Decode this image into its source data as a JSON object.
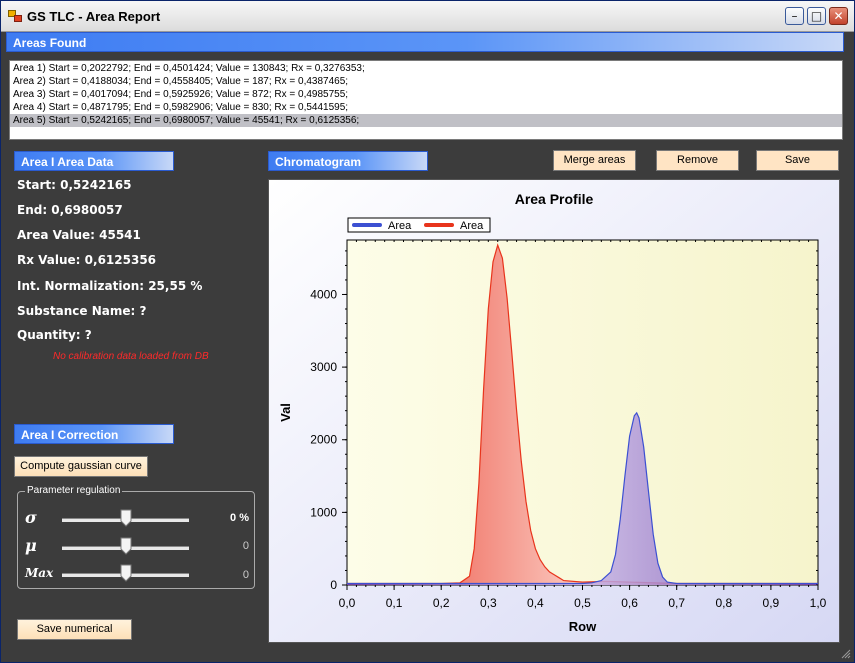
{
  "window": {
    "title": "GS TLC - Area Report",
    "min_glyph": "–",
    "max_glyph": "□",
    "close_glyph": "✕"
  },
  "areas": {
    "header": "Areas Found",
    "items": [
      "Area 1) Start = 0,2022792; End = 0,4501424; Value = 130843; Rx = 0,3276353;",
      "Area 2) Start = 0,4188034; End = 0,4558405; Value = 187; Rx = 0,4387465;",
      "Area 3) Start = 0,4017094; End = 0,5925926; Value = 872; Rx = 0,4985755;",
      "Area 4) Start = 0,4871795; End = 0,5982906; Value = 830; Rx = 0,5441595;",
      "Area 5) Start = 0,5242165; End = 0,6980057; Value = 45541; Rx = 0,6125356;"
    ],
    "selected_index": 4
  },
  "area_data": {
    "header": "Area I Area Data",
    "start": "Start: 0,5242165",
    "end": "End: 0,6980057",
    "area_value": "Area Value: 45541",
    "rx_value": "Rx Value: 0,6125356",
    "int_norm": "Int. Normalization: 25,55 %",
    "substance": "Substance Name:  ?",
    "quantity": "Quantity:  ?",
    "warning": "No calibration data loaded from DB"
  },
  "correction": {
    "header": "Area I Correction",
    "gauss_button": "Compute gaussian curve",
    "group_title": "Parameter regulation",
    "params": [
      {
        "label": "σ",
        "value": "0 %"
      },
      {
        "label": "μ",
        "value": "0"
      },
      {
        "label": "Max",
        "value": "0"
      }
    ],
    "save_numerical": "Save numerical"
  },
  "chromatogram": {
    "header": "Chromatogram",
    "merge_button": "Merge areas",
    "remove_button": "Remove",
    "save_button": "Save"
  },
  "colors": {
    "area_blue": "#3c50d2",
    "area_red": "#e8341c",
    "plot_bg": "#fafad8",
    "header_blue": "#3e7cf2"
  },
  "chart_data": {
    "type": "area",
    "title": "Area Profile",
    "xlabel": "Row",
    "ylabel": "Val",
    "xlim": [
      0,
      1
    ],
    "ylim": [
      0,
      4750
    ],
    "x_ticks": [
      0,
      0.1,
      0.2,
      0.3,
      0.4,
      0.5,
      0.6,
      0.7,
      0.8,
      0.9,
      1.0
    ],
    "x_tick_labels": [
      "0,0",
      "0,1",
      "0,2",
      "0,3",
      "0,4",
      "0,5",
      "0,6",
      "0,7",
      "0,8",
      "0,9",
      "1,0"
    ],
    "y_ticks": [
      0,
      1000,
      2000,
      3000,
      4000
    ],
    "y_tick_labels": [
      "0",
      "1000",
      "2000",
      "3000",
      "4000"
    ],
    "legend_position": "top-left",
    "series": [
      {
        "name": "Area",
        "color": "#3c50d2",
        "x": [
          0.0,
          0.5,
          0.52,
          0.54,
          0.56,
          0.57,
          0.58,
          0.59,
          0.6,
          0.61,
          0.615,
          0.62,
          0.63,
          0.64,
          0.65,
          0.66,
          0.67,
          0.68,
          0.7,
          1.0
        ],
        "y": [
          20,
          20,
          30,
          60,
          180,
          420,
          900,
          1500,
          2050,
          2330,
          2370,
          2300,
          1900,
          1300,
          700,
          300,
          110,
          40,
          20,
          20
        ]
      },
      {
        "name": "Area",
        "color": "#e8341c",
        "x": [
          0.0,
          0.2,
          0.24,
          0.26,
          0.27,
          0.28,
          0.29,
          0.3,
          0.31,
          0.32,
          0.33,
          0.34,
          0.35,
          0.36,
          0.37,
          0.38,
          0.39,
          0.4,
          0.41,
          0.42,
          0.43,
          0.44,
          0.45,
          0.46,
          0.5,
          0.55,
          0.6,
          0.7,
          1.0
        ],
        "y": [
          20,
          20,
          30,
          120,
          500,
          1400,
          2700,
          3800,
          4450,
          4680,
          4500,
          3950,
          3200,
          2400,
          1700,
          1150,
          750,
          500,
          350,
          250,
          180,
          140,
          100,
          60,
          40,
          50,
          40,
          20,
          20
        ]
      }
    ]
  }
}
